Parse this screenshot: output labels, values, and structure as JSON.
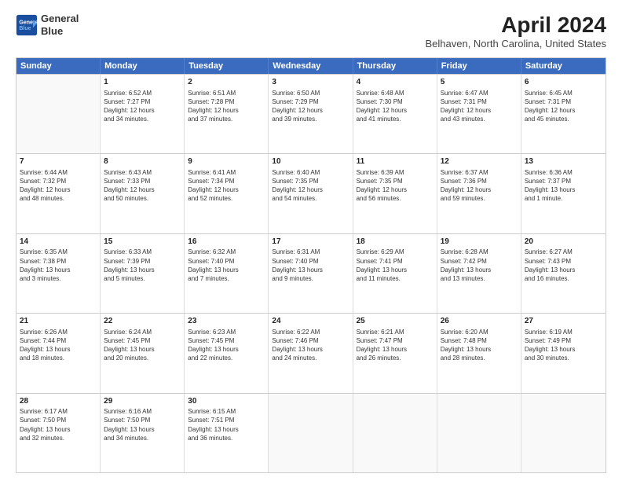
{
  "logo": {
    "line1": "General",
    "line2": "Blue"
  },
  "title": "April 2024",
  "subtitle": "Belhaven, North Carolina, United States",
  "days": [
    "Sunday",
    "Monday",
    "Tuesday",
    "Wednesday",
    "Thursday",
    "Friday",
    "Saturday"
  ],
  "weeks": [
    [
      {
        "day": "",
        "info": ""
      },
      {
        "day": "1",
        "info": "Sunrise: 6:52 AM\nSunset: 7:27 PM\nDaylight: 12 hours\nand 34 minutes."
      },
      {
        "day": "2",
        "info": "Sunrise: 6:51 AM\nSunset: 7:28 PM\nDaylight: 12 hours\nand 37 minutes."
      },
      {
        "day": "3",
        "info": "Sunrise: 6:50 AM\nSunset: 7:29 PM\nDaylight: 12 hours\nand 39 minutes."
      },
      {
        "day": "4",
        "info": "Sunrise: 6:48 AM\nSunset: 7:30 PM\nDaylight: 12 hours\nand 41 minutes."
      },
      {
        "day": "5",
        "info": "Sunrise: 6:47 AM\nSunset: 7:31 PM\nDaylight: 12 hours\nand 43 minutes."
      },
      {
        "day": "6",
        "info": "Sunrise: 6:45 AM\nSunset: 7:31 PM\nDaylight: 12 hours\nand 45 minutes."
      }
    ],
    [
      {
        "day": "7",
        "info": "Sunrise: 6:44 AM\nSunset: 7:32 PM\nDaylight: 12 hours\nand 48 minutes."
      },
      {
        "day": "8",
        "info": "Sunrise: 6:43 AM\nSunset: 7:33 PM\nDaylight: 12 hours\nand 50 minutes."
      },
      {
        "day": "9",
        "info": "Sunrise: 6:41 AM\nSunset: 7:34 PM\nDaylight: 12 hours\nand 52 minutes."
      },
      {
        "day": "10",
        "info": "Sunrise: 6:40 AM\nSunset: 7:35 PM\nDaylight: 12 hours\nand 54 minutes."
      },
      {
        "day": "11",
        "info": "Sunrise: 6:39 AM\nSunset: 7:35 PM\nDaylight: 12 hours\nand 56 minutes."
      },
      {
        "day": "12",
        "info": "Sunrise: 6:37 AM\nSunset: 7:36 PM\nDaylight: 12 hours\nand 59 minutes."
      },
      {
        "day": "13",
        "info": "Sunrise: 6:36 AM\nSunset: 7:37 PM\nDaylight: 13 hours\nand 1 minute."
      }
    ],
    [
      {
        "day": "14",
        "info": "Sunrise: 6:35 AM\nSunset: 7:38 PM\nDaylight: 13 hours\nand 3 minutes."
      },
      {
        "day": "15",
        "info": "Sunrise: 6:33 AM\nSunset: 7:39 PM\nDaylight: 13 hours\nand 5 minutes."
      },
      {
        "day": "16",
        "info": "Sunrise: 6:32 AM\nSunset: 7:40 PM\nDaylight: 13 hours\nand 7 minutes."
      },
      {
        "day": "17",
        "info": "Sunrise: 6:31 AM\nSunset: 7:40 PM\nDaylight: 13 hours\nand 9 minutes."
      },
      {
        "day": "18",
        "info": "Sunrise: 6:29 AM\nSunset: 7:41 PM\nDaylight: 13 hours\nand 11 minutes."
      },
      {
        "day": "19",
        "info": "Sunrise: 6:28 AM\nSunset: 7:42 PM\nDaylight: 13 hours\nand 13 minutes."
      },
      {
        "day": "20",
        "info": "Sunrise: 6:27 AM\nSunset: 7:43 PM\nDaylight: 13 hours\nand 16 minutes."
      }
    ],
    [
      {
        "day": "21",
        "info": "Sunrise: 6:26 AM\nSunset: 7:44 PM\nDaylight: 13 hours\nand 18 minutes."
      },
      {
        "day": "22",
        "info": "Sunrise: 6:24 AM\nSunset: 7:45 PM\nDaylight: 13 hours\nand 20 minutes."
      },
      {
        "day": "23",
        "info": "Sunrise: 6:23 AM\nSunset: 7:45 PM\nDaylight: 13 hours\nand 22 minutes."
      },
      {
        "day": "24",
        "info": "Sunrise: 6:22 AM\nSunset: 7:46 PM\nDaylight: 13 hours\nand 24 minutes."
      },
      {
        "day": "25",
        "info": "Sunrise: 6:21 AM\nSunset: 7:47 PM\nDaylight: 13 hours\nand 26 minutes."
      },
      {
        "day": "26",
        "info": "Sunrise: 6:20 AM\nSunset: 7:48 PM\nDaylight: 13 hours\nand 28 minutes."
      },
      {
        "day": "27",
        "info": "Sunrise: 6:19 AM\nSunset: 7:49 PM\nDaylight: 13 hours\nand 30 minutes."
      }
    ],
    [
      {
        "day": "28",
        "info": "Sunrise: 6:17 AM\nSunset: 7:50 PM\nDaylight: 13 hours\nand 32 minutes."
      },
      {
        "day": "29",
        "info": "Sunrise: 6:16 AM\nSunset: 7:50 PM\nDaylight: 13 hours\nand 34 minutes."
      },
      {
        "day": "30",
        "info": "Sunrise: 6:15 AM\nSunset: 7:51 PM\nDaylight: 13 hours\nand 36 minutes."
      },
      {
        "day": "",
        "info": ""
      },
      {
        "day": "",
        "info": ""
      },
      {
        "day": "",
        "info": ""
      },
      {
        "day": "",
        "info": ""
      }
    ]
  ]
}
